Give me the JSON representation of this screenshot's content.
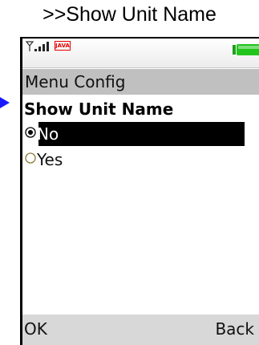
{
  "caption": ">>Show Unit Name",
  "status_bar": {
    "java_badge": "JAVA",
    "signal_icon": "signal-strength-icon",
    "battery_icon": "battery-icon",
    "battery_color": "#22c41e"
  },
  "title_bar": {
    "title": "Menu Config"
  },
  "setting": {
    "heading": "Show Unit Name",
    "options": [
      {
        "label": "No",
        "selected": true
      },
      {
        "label": "Yes",
        "selected": false
      }
    ]
  },
  "softkeys": {
    "left": "OK",
    "right": "Back"
  },
  "colors": {
    "pointer": "#1a1aff",
    "title_bar_bg": "#c0c0c0",
    "selection_bg": "#000000"
  }
}
